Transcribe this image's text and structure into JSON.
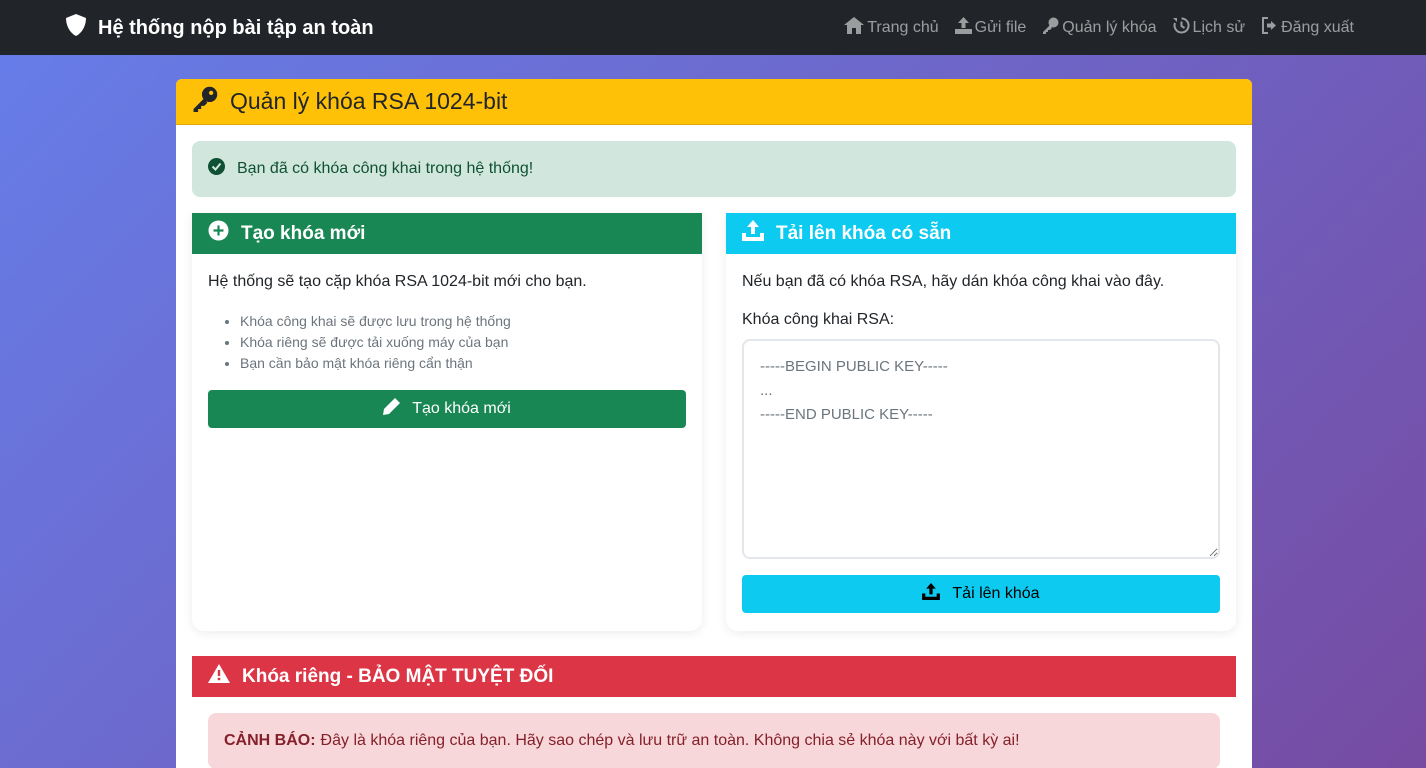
{
  "navbar": {
    "brand": "Hệ thống nộp bài tập an toàn",
    "links": [
      {
        "label": "Trang chủ",
        "icon": "home-icon"
      },
      {
        "label": "Gửi file",
        "icon": "upload-icon"
      },
      {
        "label": "Quản lý khóa",
        "icon": "key-icon"
      },
      {
        "label": "Lịch sử",
        "icon": "history-icon"
      },
      {
        "label": "Đăng xuất",
        "icon": "logout-icon"
      }
    ]
  },
  "main": {
    "title": "Quản lý khóa RSA 1024-bit",
    "success_alert": "Bạn đã có khóa công khai trong hệ thống!"
  },
  "create_card": {
    "title": "Tạo khóa mới",
    "description": "Hệ thống sẽ tạo cặp khóa RSA 1024-bit mới cho bạn.",
    "bullets": [
      "Khóa công khai sẽ được lưu trong hệ thống",
      "Khóa riêng sẽ được tải xuống máy của bạn",
      "Bạn cần bảo mật khóa riêng cẩn thận"
    ],
    "button_label": "Tạo khóa mới"
  },
  "upload_card": {
    "title": "Tải lên khóa có sẵn",
    "description": "Nếu bạn đã có khóa RSA, hãy dán khóa công khai vào đây.",
    "field_label": "Khóa công khai RSA:",
    "textarea_placeholder": "-----BEGIN PUBLIC KEY-----\n...\n-----END PUBLIC KEY-----",
    "button_label": "Tải lên khóa"
  },
  "private_key_card": {
    "title": "Khóa riêng - BẢO MẬT TUYỆT ĐỐI",
    "warning_label": "CẢNH BÁO:",
    "warning_text": "Đây là khóa riêng của bạn. Hãy sao chép và lưu trữ an toàn. Không chia sẻ khóa này với bất kỳ ai!"
  },
  "colors": {
    "navbar": "#212529",
    "warning_header": "#ffc107",
    "success": "#198754",
    "info": "#0dcaf0",
    "danger": "#dc3545"
  }
}
